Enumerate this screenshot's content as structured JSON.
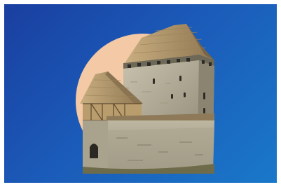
{
  "image": {
    "subject": "medieval-castle-illustration",
    "colors": {
      "bg_start": "#1a3fa0",
      "bg_end": "#1a78c9",
      "circle": "#f3c9a6",
      "stone": "#b9b29e",
      "stone_dark": "#7e7865",
      "roof": "#b49a6f",
      "roof_dark": "#7a6445",
      "timber": "#a88c5e"
    }
  }
}
